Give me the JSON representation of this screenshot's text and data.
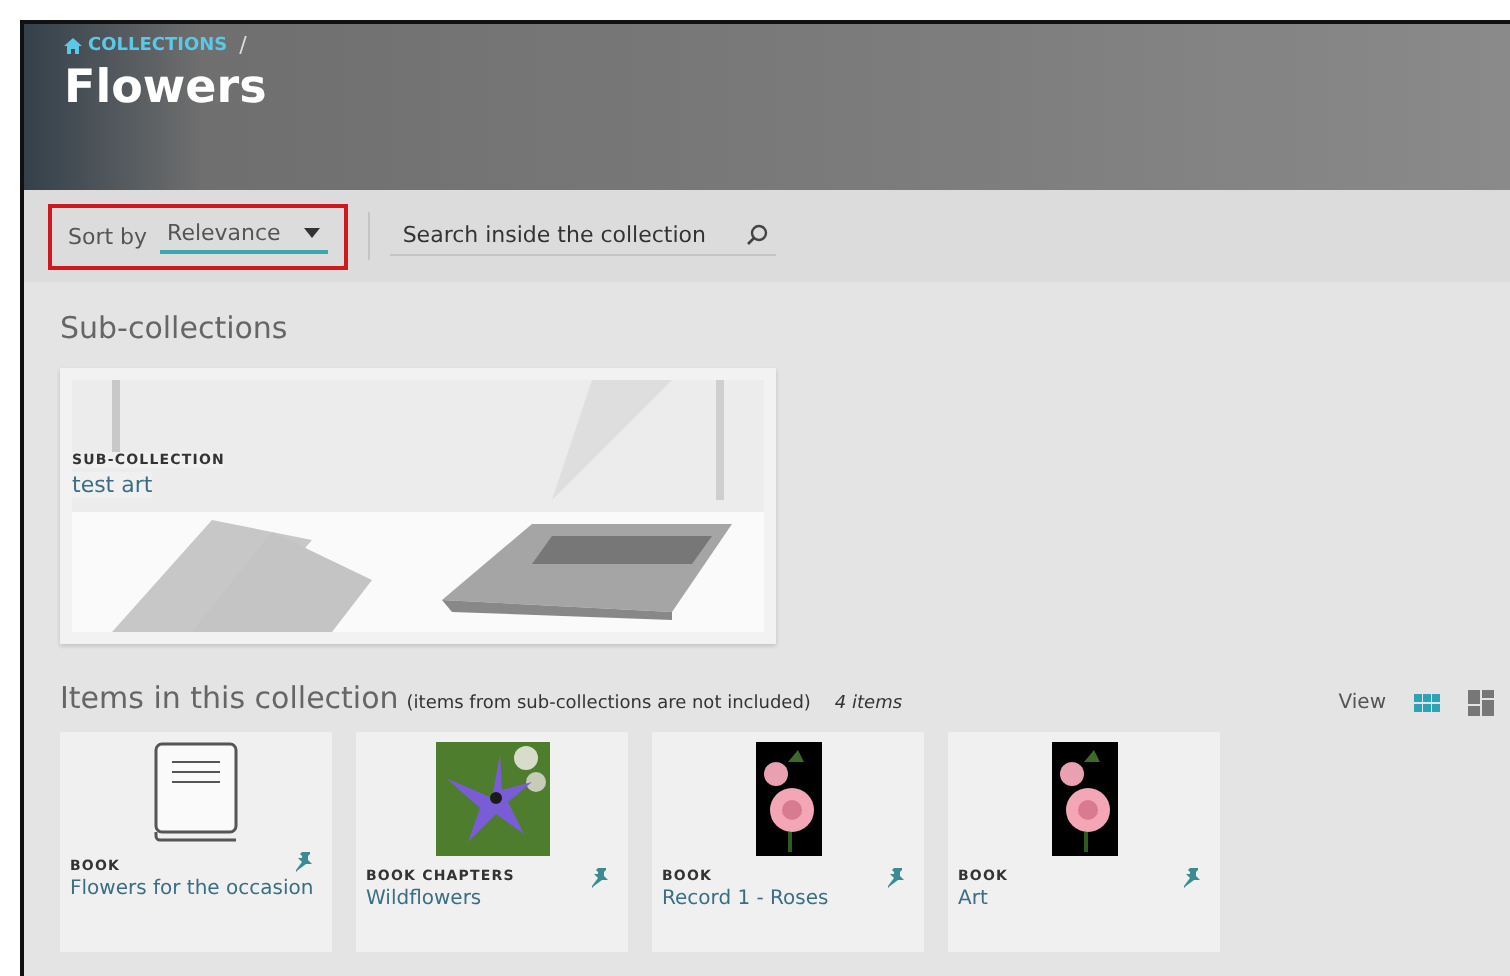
{
  "breadcrumb": {
    "label": "COLLECTIONS",
    "separator": "/"
  },
  "title": "Flowers",
  "toolbar": {
    "sort_label": "Sort by",
    "sort_value": "Relevance",
    "highlighted": true,
    "search_placeholder": "Search inside the collection"
  },
  "subcollections": {
    "heading": "Sub-collections",
    "cards": [
      {
        "type_label": "SUB-COLLECTION",
        "title": "test art"
      }
    ]
  },
  "items": {
    "heading": "Items in this collection",
    "note": "(items from sub-collections are not included)",
    "count": "4 items",
    "view_label": "View",
    "view_modes": [
      {
        "kind": "grid",
        "selected": true
      },
      {
        "kind": "mosaic",
        "selected": false
      }
    ],
    "cards": [
      {
        "kind": "book",
        "type_label": "BOOK",
        "title": "Flowers for the occasion"
      },
      {
        "kind": "flower",
        "type_label": "BOOK CHAPTERS",
        "title": "Wildflowers"
      },
      {
        "kind": "rose",
        "type_label": "BOOK",
        "title": "Record 1 - Roses"
      },
      {
        "kind": "rose",
        "type_label": "BOOK",
        "title": "Art"
      }
    ]
  }
}
